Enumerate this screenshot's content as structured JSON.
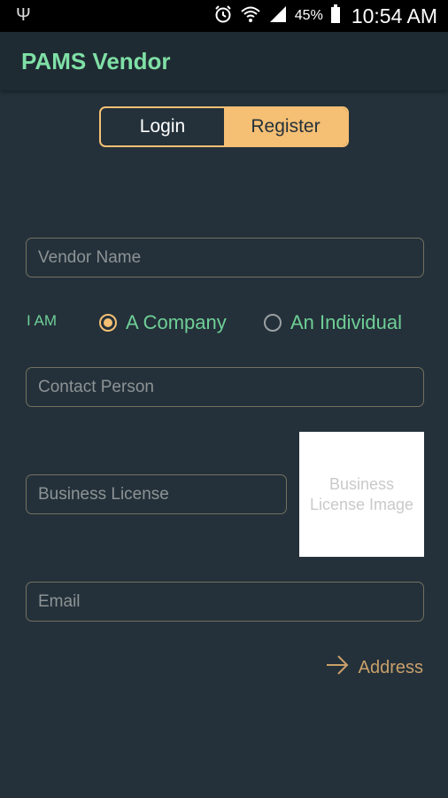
{
  "status_bar": {
    "usb_icon": "usb-icon",
    "battery_percent": "45%",
    "time": "10:54 AM"
  },
  "app": {
    "title": "PAMS Vendor"
  },
  "tabs": [
    {
      "label": "Login",
      "selected": false
    },
    {
      "label": "Register",
      "selected": true
    }
  ],
  "form": {
    "vendor_name": {
      "placeholder": "Vendor Name",
      "value": ""
    },
    "iam_label": "I AM",
    "options": [
      {
        "label": "A Company",
        "selected": true
      },
      {
        "label": "An Individual",
        "selected": false
      }
    ],
    "contact_person": {
      "placeholder": "Contact Person",
      "value": ""
    },
    "business_license": {
      "placeholder": "Business License",
      "value": ""
    },
    "license_image_label": "Business License Image",
    "email": {
      "placeholder": "Email",
      "value": ""
    },
    "next_label": "Address"
  },
  "colors": {
    "accent": "#f5bf74",
    "title_green": "#7fe0a6",
    "background": "#24313a"
  }
}
